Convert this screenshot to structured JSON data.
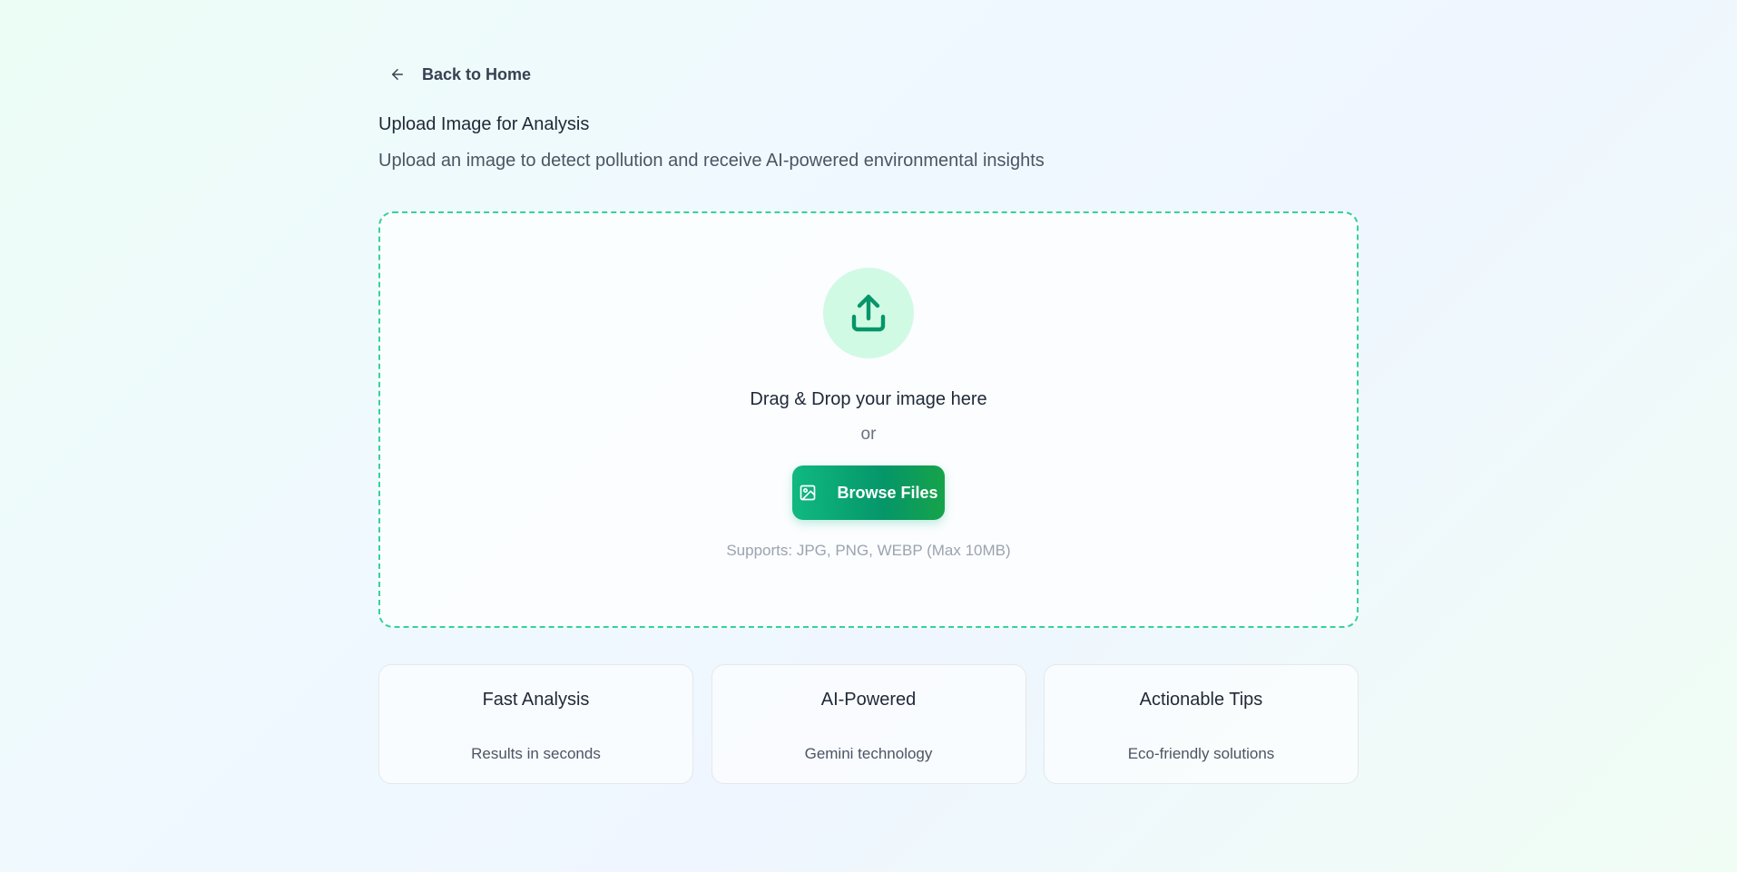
{
  "nav": {
    "back_label": "Back to Home"
  },
  "header": {
    "title": "Upload Image for Analysis",
    "subtitle": "Upload an image to detect pollution and receive AI-powered environmental insights"
  },
  "dropzone": {
    "icon": "upload-icon",
    "drag_text": "Drag & Drop your image here",
    "or_text": "or",
    "browse_label": "Browse Files",
    "browse_icon": "image-icon",
    "supports_text": "Supports: JPG, PNG, WEBP (Max 10MB)"
  },
  "features": [
    {
      "title": "Fast Analysis",
      "description": "Results in seconds"
    },
    {
      "title": "AI-Powered",
      "description": "Gemini technology"
    },
    {
      "title": "Actionable Tips",
      "description": "Eco-friendly solutions"
    }
  ],
  "colors": {
    "accent": "#10b981",
    "accent_dark": "#059669",
    "dropzone_border": "#34d399",
    "icon_circle": "#d1fae5"
  }
}
